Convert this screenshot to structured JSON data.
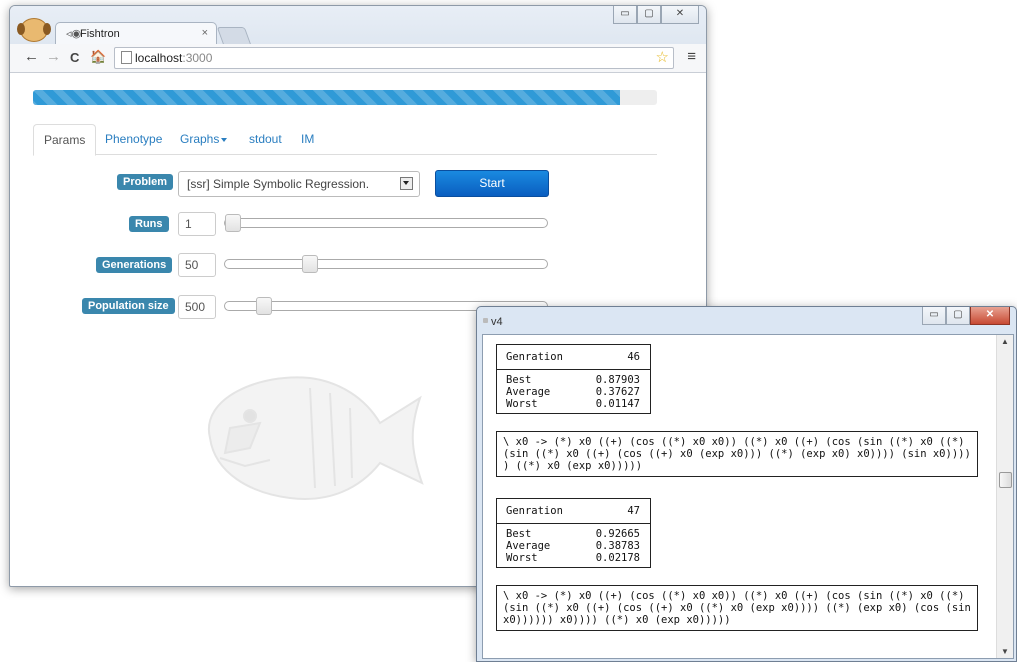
{
  "browser": {
    "tab_title": "Fishtron",
    "tab_icon": "fish-icon",
    "close_glyph": "×",
    "url_host": "localhost",
    "url_port": ":3000",
    "back_glyph": "←",
    "forward_glyph": "→",
    "reload_glyph": "C",
    "home_glyph": "🏠",
    "star_glyph": "☆",
    "menu_glyph": "≡"
  },
  "window_controls": {
    "minimize": "▭",
    "maximize": "▢",
    "close": "✕"
  },
  "progress": {
    "fraction": 0.94,
    "color": "#2f9ad7"
  },
  "tabs": [
    {
      "label": "Params",
      "active": true
    },
    {
      "label": "Phenotype",
      "active": false
    },
    {
      "label": "Graphs",
      "active": false,
      "dropdown": true
    },
    {
      "label": "stdout",
      "active": false
    },
    {
      "label": "IM",
      "active": false
    }
  ],
  "form": {
    "problem": {
      "label": "Problem",
      "value": "[ssr] Simple Symbolic Regression."
    },
    "start_label": "Start",
    "runs": {
      "label": "Runs",
      "value": "1",
      "slider_fraction": 0.0
    },
    "generations": {
      "label": "Generations",
      "value": "50",
      "slider_fraction": 0.25
    },
    "population": {
      "label": "Population size",
      "value": "500",
      "slider_fraction": 0.1
    }
  },
  "v4": {
    "title": "v4",
    "generations": [
      {
        "label": "Genration",
        "number": "46",
        "stats": [
          {
            "k": "Best",
            "v": "0.87903"
          },
          {
            "k": "Average",
            "v": "0.37627"
          },
          {
            "k": "Worst",
            "v": "0.01147"
          }
        ],
        "expr": "\\ x0 -> (*) x0 ((+) (cos ((*) x0 x0)) ((*) x0 ((+) (cos (sin ((*) x0 ((*) (sin ((*) x0 ((+) (cos ((+) x0 (exp x0))) ((*) (exp x0) x0)))) (sin x0)))) ) ((*) x0 (exp x0)))))"
      },
      {
        "label": "Genration",
        "number": "47",
        "stats": [
          {
            "k": "Best",
            "v": "0.92665"
          },
          {
            "k": "Average",
            "v": "0.38783"
          },
          {
            "k": "Worst",
            "v": "0.02178"
          }
        ],
        "expr": "\\ x0 -> (*) x0 ((+) (cos ((*) x0 x0)) ((*) x0 ((+) (cos (sin ((*) x0 ((*) (sin ((*) x0 ((+) (cos ((+) x0 ((*) x0 (exp x0)))) ((*) (exp x0) (cos (sin x0)))))) x0)))) ((*) x0 (exp x0)))))"
      }
    ]
  }
}
